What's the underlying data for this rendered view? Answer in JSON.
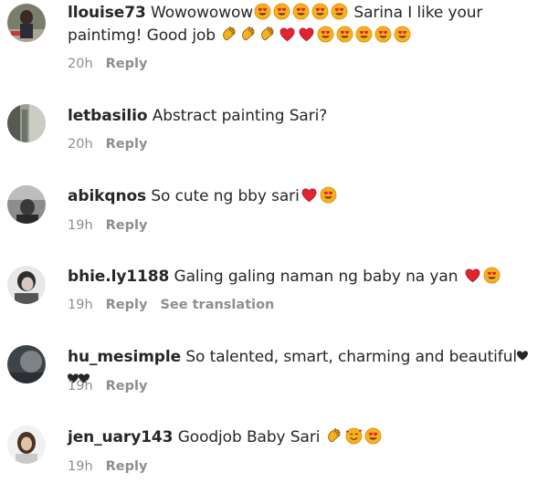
{
  "comments": [
    {
      "username": "llouise73",
      "text_a": " Wowowowow",
      "text_b": " Sarina I like your paintimg! Good job ",
      "time": "20h",
      "reply": "Reply",
      "emojis_a": [
        "heart-eyes-emoji",
        "heart-eyes-emoji",
        "heart-eyes-emoji",
        "heart-eyes-emoji",
        "heart-eyes-emoji"
      ],
      "emojis_b": [
        "clapping-hands-emoji",
        "clapping-hands-emoji",
        "clapping-hands-emoji",
        "red-heart-emoji",
        "red-heart-emoji",
        "heart-eyes-emoji",
        "heart-eyes-emoji",
        "heart-eyes-emoji",
        "heart-eyes-emoji",
        "heart-eyes-emoji"
      ]
    },
    {
      "username": "letbasilio",
      "text_a": " Abstract painting Sari?",
      "time": "20h",
      "reply": "Reply"
    },
    {
      "username": "abikqnos",
      "text_a": " So cute ng bby sari",
      "time": "19h",
      "reply": "Reply",
      "emojis_a": [
        "red-heart-emoji",
        "heart-eyes-emoji"
      ]
    },
    {
      "username": "bhie.ly1188",
      "text_a": " Galing galing naman ng baby na yan ",
      "time": "19h",
      "reply": "Reply",
      "translation": "See translation",
      "emojis_a": [
        "red-heart-emoji",
        "heart-eyes-emoji"
      ]
    },
    {
      "username": "hu_mesimple",
      "text_a": " So talented, smart, charming and beautiful",
      "time": "19h",
      "reply": "Reply",
      "emojis_a": [
        "small-black-heart",
        "small-black-heart",
        "small-black-heart"
      ]
    },
    {
      "username": "jen_uary143",
      "text_a": " Goodjob Baby Sari ",
      "time": "19h",
      "reply": "Reply",
      "emojis_a": [
        "clapping-hands-emoji",
        "smiling-hearts-emoji",
        "heart-eyes-emoji"
      ]
    }
  ],
  "colors": {
    "text": "#262626",
    "meta": "#8e8e8e",
    "emoji_yellow": "#f7b21b",
    "emoji_heart": "#e0252f"
  }
}
